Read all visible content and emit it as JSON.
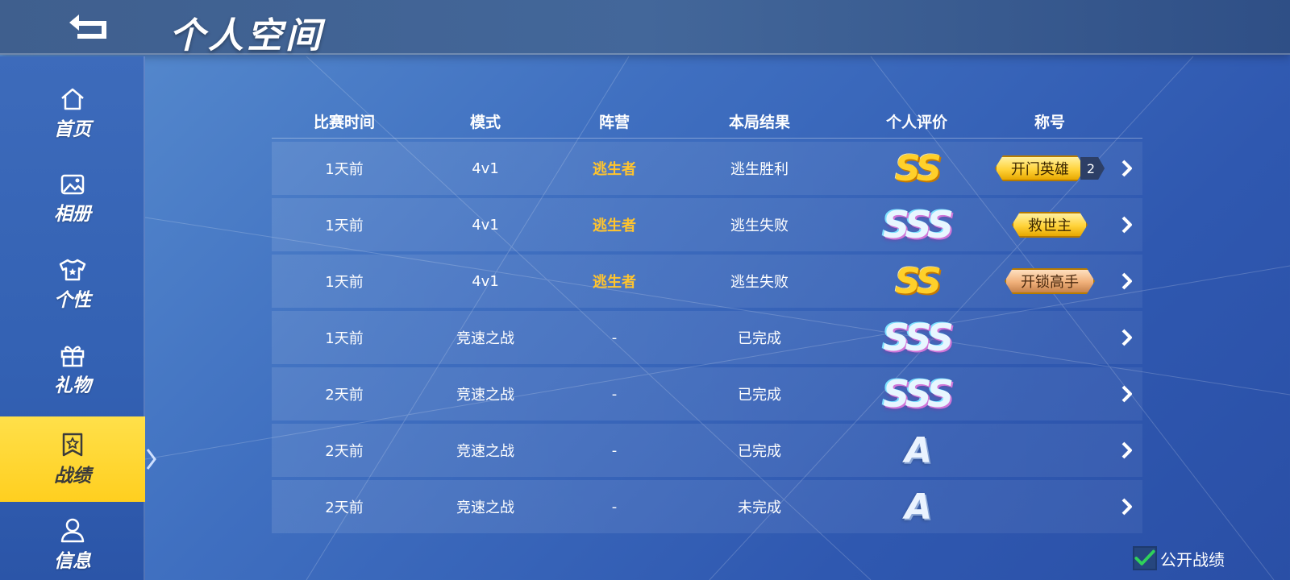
{
  "header": {
    "title": "个人空间",
    "back_icon": "back-arrow-icon"
  },
  "sidebar": {
    "items": [
      {
        "label": "首页",
        "icon": "home-icon"
      },
      {
        "label": "相册",
        "icon": "image-icon"
      },
      {
        "label": "个性",
        "icon": "shirt-icon"
      },
      {
        "label": "礼物",
        "icon": "gift-icon"
      },
      {
        "label": "战绩",
        "icon": "badge-star-icon",
        "active": true
      },
      {
        "label": "信息",
        "icon": "user-icon"
      }
    ]
  },
  "table": {
    "headers": [
      "比赛时间",
      "模式",
      "阵营",
      "本局结果",
      "个人评价",
      "称号"
    ],
    "rows": [
      {
        "time": "1天前",
        "mode": "4v1",
        "camp": "逃生者",
        "result": "逃生胜利",
        "grade": "SS",
        "title": "开门英雄",
        "title_count": "2",
        "title_style": "gold"
      },
      {
        "time": "1天前",
        "mode": "4v1",
        "camp": "逃生者",
        "result": "逃生失败",
        "grade": "SSS",
        "title": "救世主",
        "title_style": "gold"
      },
      {
        "time": "1天前",
        "mode": "4v1",
        "camp": "逃生者",
        "result": "逃生失败",
        "grade": "SS",
        "title": "开锁高手",
        "title_style": "bronze"
      },
      {
        "time": "1天前",
        "mode": "竞速之战",
        "camp": "-",
        "result": "已完成",
        "grade": "SSS"
      },
      {
        "time": "2天前",
        "mode": "竞速之战",
        "camp": "-",
        "result": "已完成",
        "grade": "SSS"
      },
      {
        "time": "2天前",
        "mode": "竞速之战",
        "camp": "-",
        "result": "已完成",
        "grade": "A"
      },
      {
        "time": "2天前",
        "mode": "竞速之战",
        "camp": "-",
        "result": "未完成",
        "grade": "A"
      }
    ]
  },
  "public_toggle": {
    "label": "公开战绩",
    "checked": true
  },
  "colors": {
    "accent_yellow": "#ffcf1f",
    "survivor_orange": "#ffc42e",
    "check_green": "#2fd15a"
  }
}
